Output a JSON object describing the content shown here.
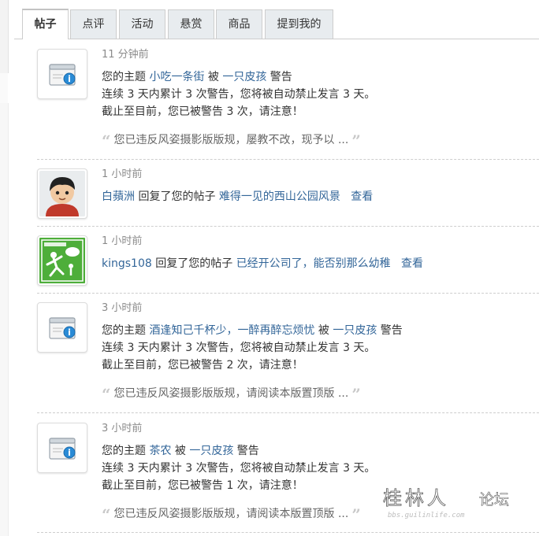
{
  "tabs": [
    "帖子",
    "点评",
    "活动",
    "悬赏",
    "商品",
    "提到我的"
  ],
  "notices": [
    {
      "time": "11 分钟前",
      "l1_pre": "您的主题 ",
      "l1_link": "小吃一条街",
      "l1_mid": " 被 ",
      "l1_user": "一只皮孩",
      "l1_post": " 警告",
      "l2": "连续 3 天内累计 3 次警告，您将被自动禁止发言 3 天。",
      "l3": "截止至目前，您已被警告 3 次，请注意！",
      "quote": "您已违反风姿摄影版版规，屡教不改，现予以 ..."
    },
    {
      "time": "3 小时前",
      "l1_pre": "您的主题 ",
      "l1_link": "酒逢知己千杯少，一醉再醉忘烦忧",
      "l1_mid": " 被 ",
      "l1_user": "一只皮孩",
      "l1_post": " 警告",
      "l2": "连续 3 天内累计 3 次警告，您将被自动禁止发言 3 天。",
      "l3": "截止至目前，您已被警告 2 次，请注意！",
      "quote": "您已违反风姿摄影版版规，请阅读本版置顶版 ..."
    },
    {
      "time": "3 小时前",
      "l1_pre": "您的主题 ",
      "l1_link": "茶农",
      "l1_mid": " 被 ",
      "l1_user": "一只皮孩",
      "l1_post": " 警告",
      "l2": "连续 3 天内累计 3 次警告，您将被自动禁止发言 3 天。",
      "l3": "截止至目前，您已被警告 1 次，请注意！",
      "quote": "您已违反风姿摄影版版规，请阅读本版置顶版 ..."
    }
  ],
  "replies": [
    {
      "time": "1 小时前",
      "user": "白蘋洲",
      "action": " 回复了您的帖子 ",
      "thread": "难得一见的西山公园风景",
      "view": "查看"
    },
    {
      "time": "1 小时前",
      "user": "kings108",
      "action": " 回复了您的帖子 ",
      "thread": "已经开公司了，能否别那么幼稚",
      "view": "查看"
    }
  ],
  "watermark": {
    "title": "桂林人",
    "subtitle": "论坛",
    "url": "bbs.guilinlife.com"
  },
  "colors": {
    "link": "#336699",
    "time": "#8b8b8b",
    "tab_bg": "#e8ecef",
    "border": "#cdcdcd"
  }
}
